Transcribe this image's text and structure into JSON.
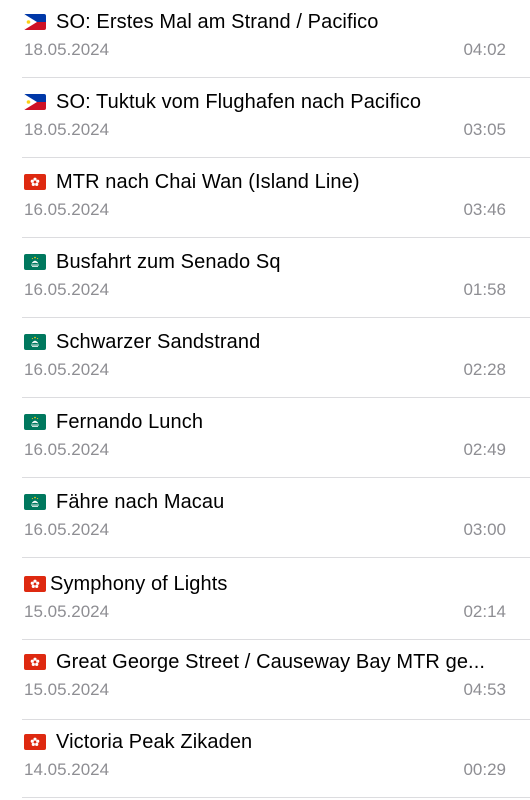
{
  "recordings": [
    {
      "flag": "philippines-flag-icon",
      "title": "SO: Erstes Mal am Strand / Pacifico",
      "date": "18.05.2024",
      "duration": "04:02"
    },
    {
      "flag": "philippines-flag-icon",
      "title": "SO: Tuktuk vom Flughafen nach Pacifico",
      "date": "18.05.2024",
      "duration": "03:05"
    },
    {
      "flag": "hong-kong-flag-icon",
      "title": "MTR nach Chai Wan (Island Line)",
      "date": "16.05.2024",
      "duration": "03:46"
    },
    {
      "flag": "macau-flag-icon",
      "title": "Busfahrt zum Senado Sq",
      "date": "16.05.2024",
      "duration": "01:58"
    },
    {
      "flag": "macau-flag-icon",
      "title": "Schwarzer Sandstrand",
      "date": "16.05.2024",
      "duration": "02:28"
    },
    {
      "flag": "macau-flag-icon",
      "title": "Fernando Lunch",
      "date": "16.05.2024",
      "duration": "02:49"
    },
    {
      "flag": "macau-flag-icon",
      "title": "Fähre nach Macau",
      "date": "16.05.2024",
      "duration": "03:00"
    },
    {
      "flag": "hong-kong-flag-icon",
      "title": "Symphony of Lights",
      "date": "15.05.2024",
      "duration": "02:14"
    },
    {
      "flag": "hong-kong-flag-icon",
      "title": "Great George Street / Causeway Bay MTR ge...",
      "date": "15.05.2024",
      "duration": "04:53"
    },
    {
      "flag": "hong-kong-flag-icon",
      "title": "Victoria Peak Zikaden",
      "date": "14.05.2024",
      "duration": "00:29"
    }
  ],
  "colors": {
    "secondary_text": "#8e8e93",
    "divider": "#dcdcdf",
    "hong_kong_red": "#de2910",
    "macau_green": "#00785e",
    "philippines_blue": "#0038a8",
    "philippines_red": "#ce1126",
    "philippines_yellow": "#fcd116"
  }
}
